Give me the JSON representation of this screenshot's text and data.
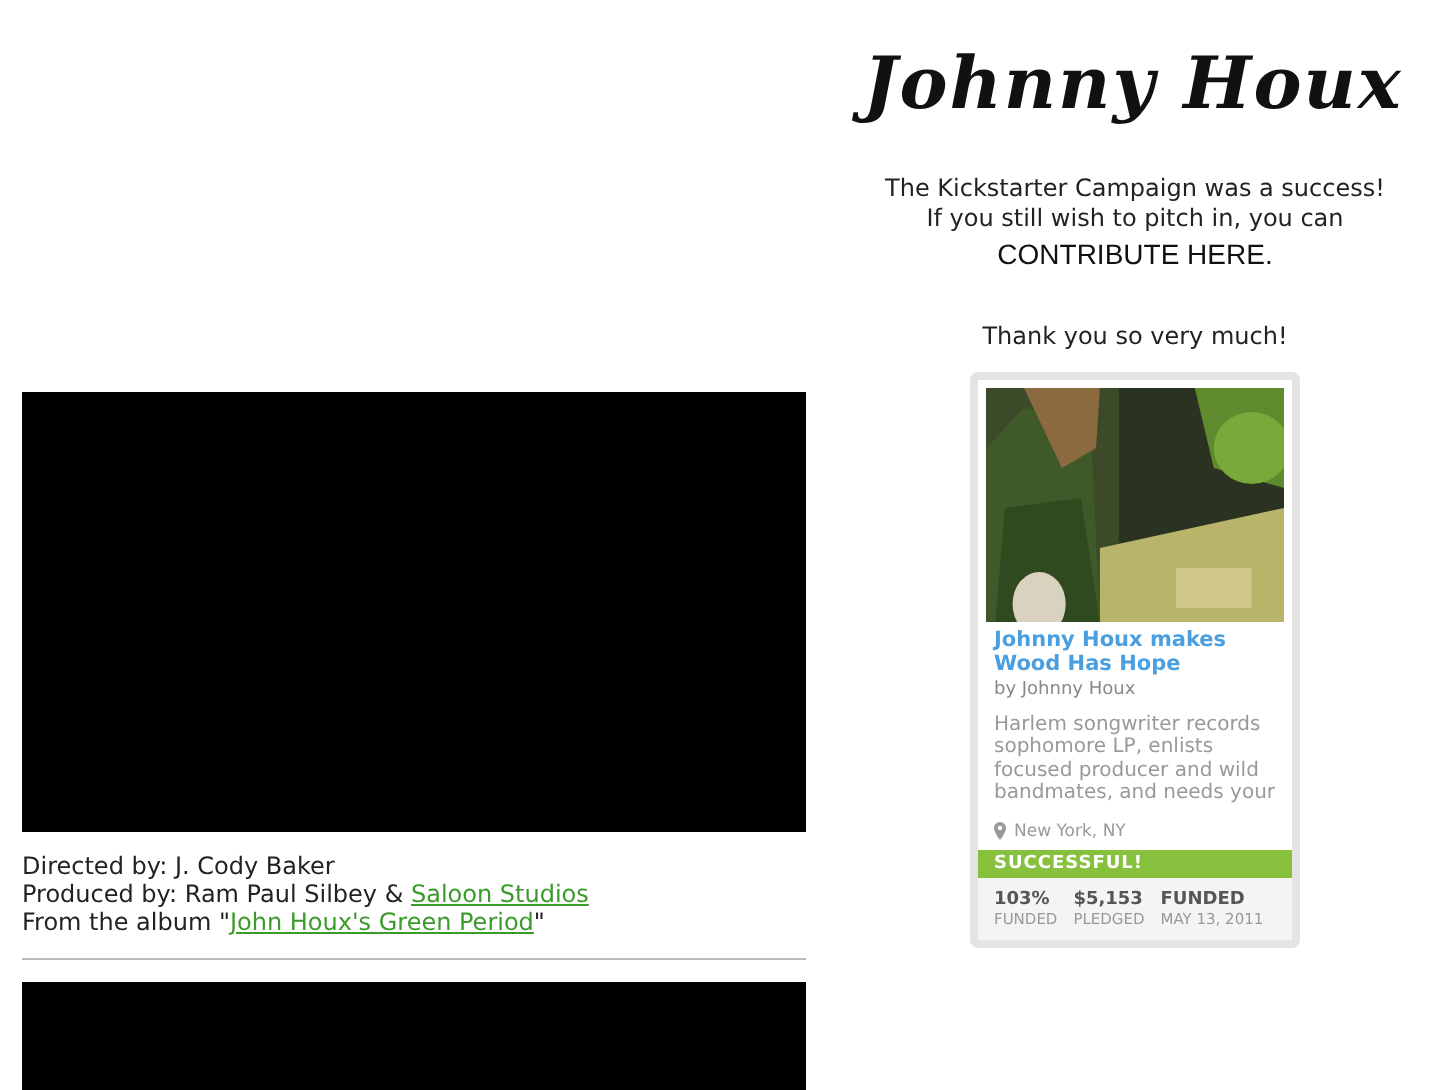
{
  "logo": {
    "text": "Johnny Houx"
  },
  "campaign_message": {
    "line_1": "The Kickstarter Campaign was a success!",
    "line_2": "If you still wish to pitch in, you can",
    "link": "CONTRIBUTE HERE.",
    "thanks": "Thank you so very much!"
  },
  "videos": [
    {
      "kind": "video"
    },
    {
      "kind": "video"
    }
  ],
  "credits": [
    {
      "text": "Directed by: J. Cody Baker"
    },
    {
      "text": "Produced by: Ram Paul Silbey & ",
      "link": "Saloon Studios"
    },
    {
      "text": "From the album \"",
      "link": "John Houx's Green Period",
      "after": "\""
    }
  ],
  "project_card": {
    "title": "Johnny Houx makes Wood Has Hope",
    "byline": "by Johnny Houx",
    "description": "Harlem songwriter records sophomore LP, enlists focused producer and wild bandmates, and needs your",
    "location": "New York, NY",
    "status": "SUCCESSFUL!",
    "stats": [
      {
        "value": "103%",
        "label": "FUNDED"
      },
      {
        "value": "$5,153",
        "label": "PLEDGED"
      },
      {
        "value": "FUNDED",
        "label": "MAY 13, 2011"
      }
    ]
  }
}
